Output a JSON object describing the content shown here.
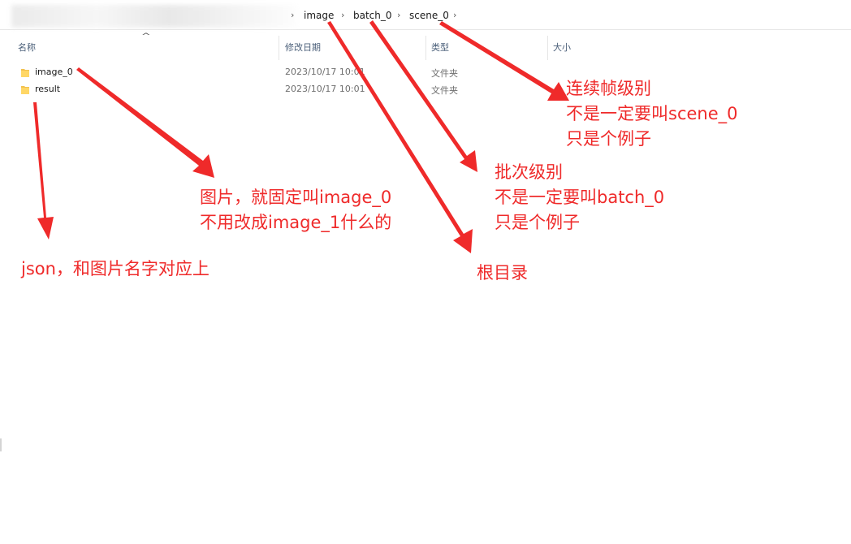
{
  "breadcrumb": {
    "items": [
      "image",
      "batch_0",
      "scene_0"
    ],
    "separator": "›"
  },
  "columns": {
    "name": "名称",
    "date": "修改日期",
    "type": "类型",
    "size": "大小"
  },
  "files": [
    {
      "name": "image_0",
      "date": "2023/10/17 10:01",
      "type": "文件夹",
      "icon": "folder-icon"
    },
    {
      "name": "result",
      "date": "2023/10/17 10:01",
      "type": "文件夹",
      "icon": "folder-icon"
    }
  ],
  "annotations": {
    "scene": [
      "连续帧级别",
      "不是一定要叫scene_0",
      "只是个例子"
    ],
    "batch": [
      "批次级别",
      "不是一定要叫batch_0",
      "只是个例子"
    ],
    "image": [
      "图片，就固定叫image_0",
      "不用改成image_1什么的"
    ],
    "root": [
      "根目录"
    ],
    "result": [
      "json，和图片名字对应上"
    ]
  },
  "colors": {
    "annotation": "#ef2a2a",
    "folder": "#f2c14e"
  }
}
